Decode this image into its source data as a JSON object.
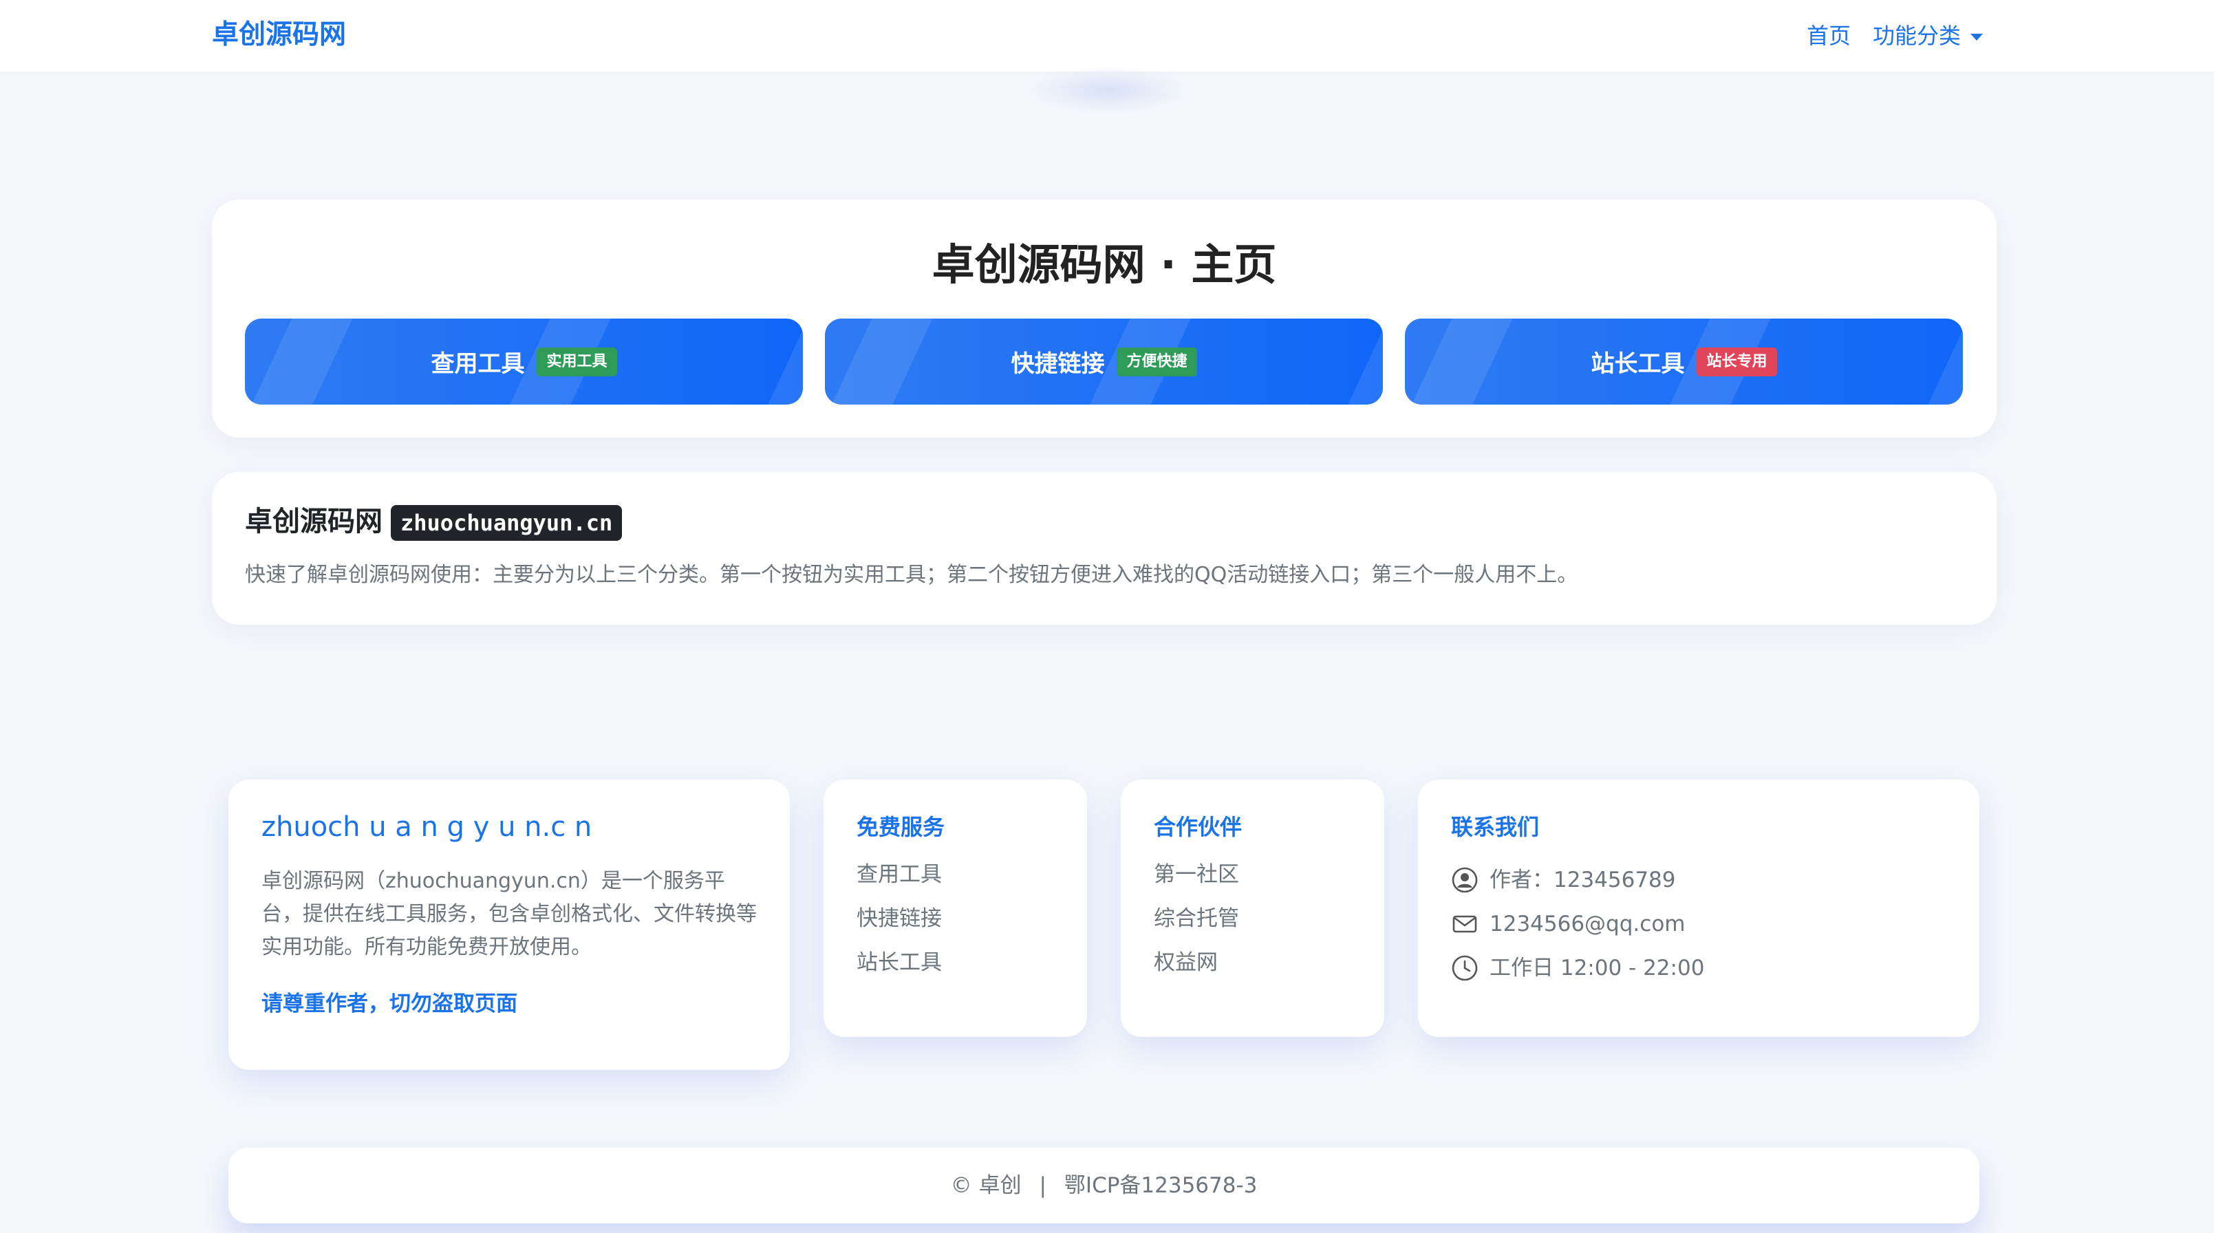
{
  "navbar": {
    "brand": "卓创源码网",
    "links": [
      {
        "label": "首页"
      },
      {
        "label": "功能分类"
      }
    ]
  },
  "hero": {
    "title": "卓创源码网 · 主页",
    "buttons": [
      {
        "label": "查用工具",
        "badge": "实用工具",
        "badge_color": "#2e9c58"
      },
      {
        "label": "快捷链接",
        "badge": "方便快捷",
        "badge_color": "#2e9c58"
      },
      {
        "label": "站长工具",
        "badge": "站长专用",
        "badge_color": "#e0455a"
      }
    ]
  },
  "intro": {
    "title": "卓创源码网",
    "domain": "zhuochuangyun.cn",
    "text": "快速了解卓创源码网使用：主要分为以上三个分类。第一个按钮为实用工具；第二个按钮方便进入难找的QQ活动链接入口；第三个一般人用不上。"
  },
  "footer": {
    "about": {
      "title": "zhuoch u a n g y u n.c n",
      "desc": "卓创源码网（zhuochuangyun.cn）是一个服务平台，提供在线工具服务，包含卓创格式化、文件转换等实用功能。所有功能免费开放使用。",
      "link": "请尊重作者，切勿盗取页面"
    },
    "services": {
      "title": "免费服务",
      "items": [
        "查用工具",
        "快捷链接",
        "站长工具"
      ]
    },
    "partners": {
      "title": "合作伙伴",
      "items": [
        "第一社区",
        "综合托管",
        "权益网"
      ]
    },
    "contact": {
      "title": "联系我们",
      "items": [
        {
          "icon": "user-circle-icon",
          "text": "作者：123456789"
        },
        {
          "icon": "envelope-icon",
          "text": "1234566@qq.com"
        },
        {
          "icon": "clock-icon",
          "text": "工作日 12:00 - 22:00"
        }
      ]
    }
  },
  "copyright": {
    "owner": "© 卓创",
    "separator": "|",
    "icp": "鄂ICP备1235678-3"
  },
  "colors": {
    "accent": "#1a73e8",
    "button": "#1066f7",
    "badge_green": "#2e9c58",
    "badge_red": "#e0455a"
  }
}
